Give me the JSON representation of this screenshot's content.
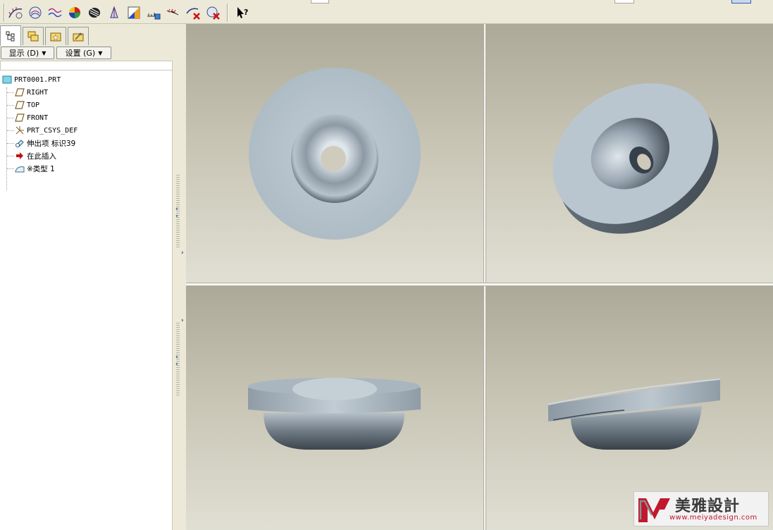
{
  "toolbar": {
    "icons": [
      "curvature-analysis-icon",
      "section-analysis-icon",
      "offset-analysis-icon",
      "shaded-curvature-icon",
      "reflection-analysis-icon",
      "draft-analysis-icon",
      "slope-analysis-icon",
      "dihedral-angle-icon",
      "curve-analysis-icon",
      "delete-analysis-icon",
      "delete-all-analysis-icon",
      "whats-this-help-icon"
    ]
  },
  "left_panel": {
    "tabs": [
      "model-tree-tab",
      "layer-tree-tab",
      "favorites-tab",
      "tools-tab"
    ],
    "show_button": "显示 (D)",
    "settings_button": "设置 (G)",
    "tree": {
      "root": "PRT0001.PRT",
      "items": [
        {
          "label": "RIGHT",
          "icon": "datum-plane-icon",
          "mono": true
        },
        {
          "label": "TOP",
          "icon": "datum-plane-icon",
          "mono": true
        },
        {
          "label": "FRONT",
          "icon": "datum-plane-icon",
          "mono": true
        },
        {
          "label": "PRT_CSYS_DEF",
          "icon": "coordinate-system-icon",
          "mono": true
        },
        {
          "label": "伸出项 标识39",
          "icon": "extrude-icon",
          "mono": false
        },
        {
          "label": "在此插入",
          "icon": "insert-here-arrow-icon",
          "mono": false
        },
        {
          "label": "※类型 1",
          "icon": "surface-feature-icon",
          "mono": false
        }
      ]
    }
  },
  "viewports": [
    "top-view",
    "isometric-view",
    "front-view",
    "side-view"
  ],
  "watermark": {
    "brand": "美雅設計",
    "url": "www.meiyadesign.com",
    "colors": {
      "accent": "#c0182e",
      "dark": "#3a3a3a"
    }
  }
}
